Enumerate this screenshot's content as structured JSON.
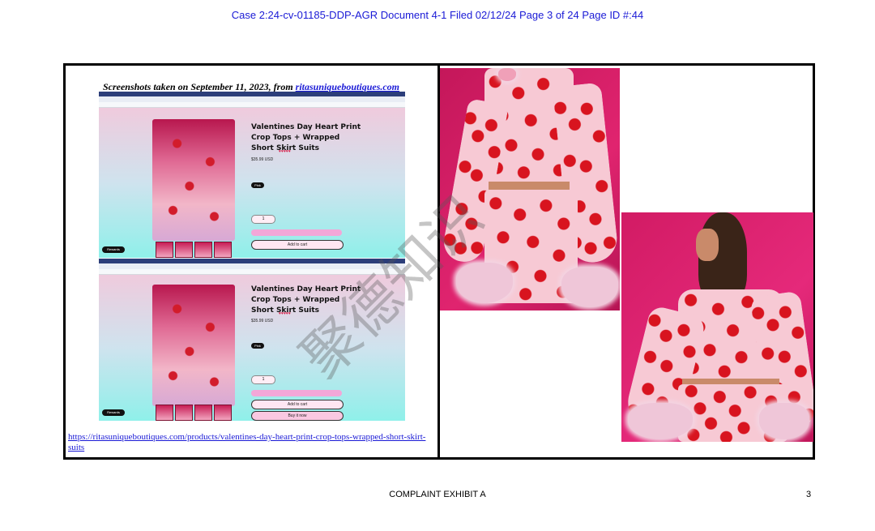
{
  "header": {
    "case_line": "Case 2:24-cv-01185-DDP-AGR   Document 4-1   Filed 02/12/24   Page 3 of 24   Page ID #:44"
  },
  "left_panel": {
    "caption_prefix": "Screenshots taken on September 11, 2023, from ",
    "caption_link": "ritasuniqueboutiques.com",
    "product_title": "Valentines Day Heart Print Crop Tops + Wrapped Short Skirt Suits",
    "price": "$35.99 USD",
    "color_label": "Pink",
    "qty_value": "1",
    "add_to_cart": "Add to cart",
    "buy_now": "Buy it now",
    "rewards": "Rewards",
    "url": "https://ritasuniqueboutiques.com/products/valentines-day-heart-print-crop-tops-wrapped-short-skirt-suits"
  },
  "watermark": "聚德知识",
  "footer": {
    "exhibit_label": "COMPLAINT EXHIBIT A",
    "page_number": "3"
  },
  "colors": {
    "link_blue": "#1a1ad6",
    "backdrop_magenta": "#e0246f",
    "heart_red": "#d8141f",
    "dress_pink": "#f7c9d4"
  }
}
